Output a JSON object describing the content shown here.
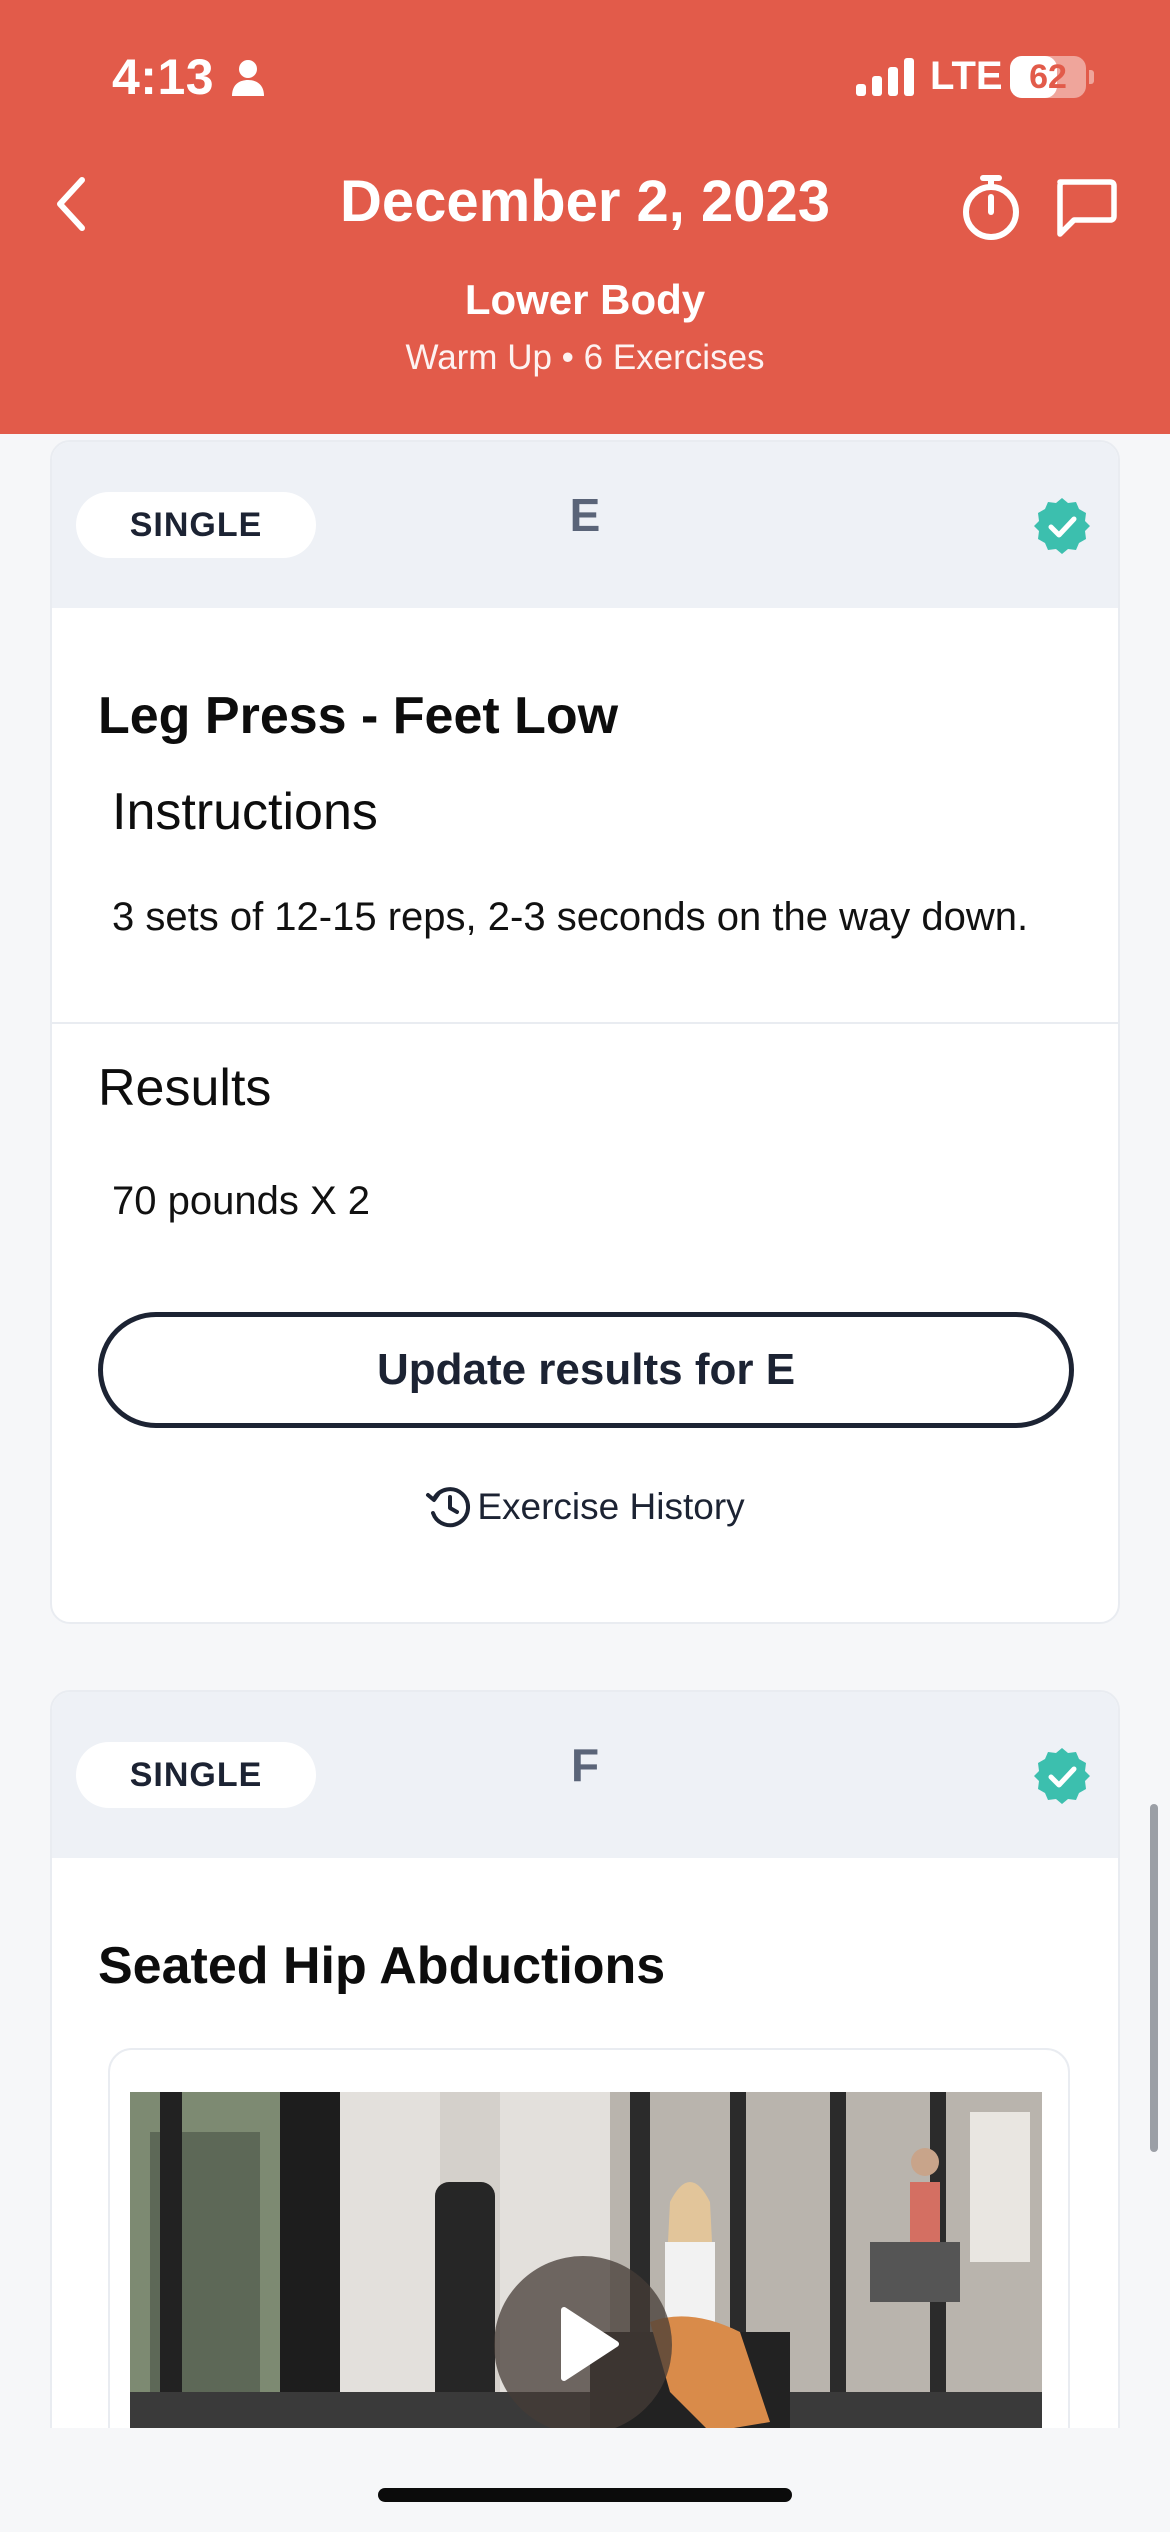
{
  "status_bar": {
    "time": "4:13",
    "carrier": "LTE",
    "battery_percent": "62",
    "battery_level": 0.62
  },
  "header": {
    "title": "December 2, 2023",
    "workout_name": "Lower Body",
    "subtitle": "Warm Up • 6 Exercises",
    "background_color": "#e25b4a",
    "icons": [
      "chevron-left-icon",
      "stopwatch-icon",
      "chat-bubble-icon"
    ]
  },
  "cards": [
    {
      "type_label": "SINGLE",
      "letter": "E",
      "completed": true,
      "exercise_name": "Leg Press - Feet Low",
      "instructions_heading": "Instructions",
      "instructions": "3 sets of 12-15 reps, 2-3 seconds on the way down.",
      "results_heading": "Results",
      "result_value": "70 pounds X 2",
      "update_button": "Update results for E",
      "history_link": "Exercise History"
    },
    {
      "type_label": "SINGLE",
      "letter": "F",
      "completed": true,
      "exercise_name": "Seated Hip Abductions",
      "has_video": true
    }
  ],
  "colors": {
    "accent": "#e25b4a",
    "check": "#3cbfae",
    "dark": "#1c2333"
  }
}
